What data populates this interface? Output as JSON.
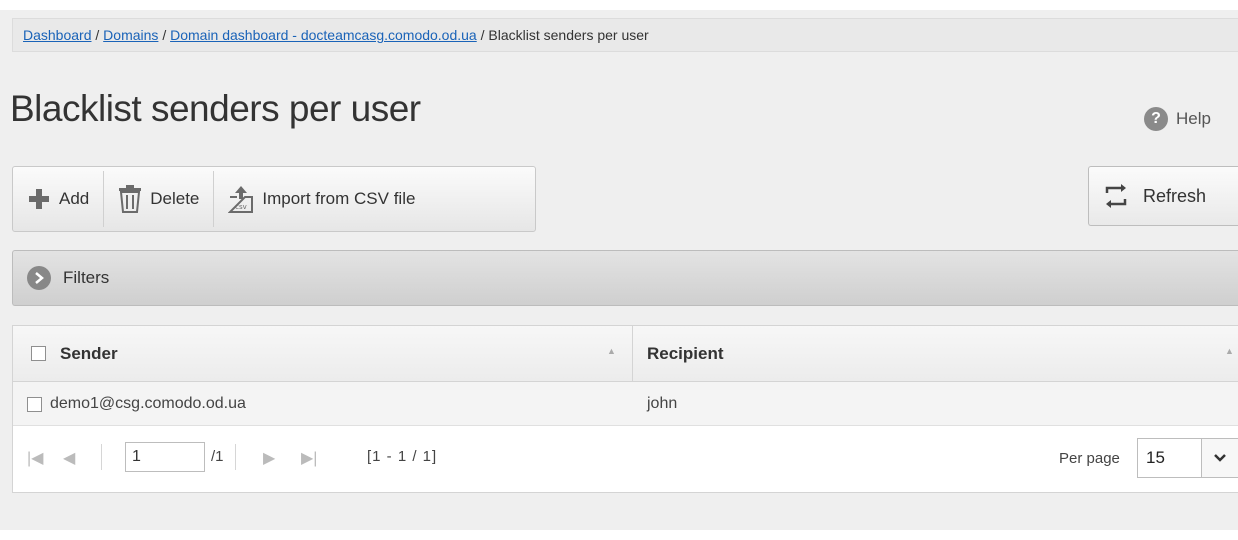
{
  "breadcrumb": {
    "items": [
      {
        "label": "Dashboard"
      },
      {
        "label": "Domains"
      },
      {
        "label": "Domain dashboard - docteamcasg.comodo.od.ua"
      }
    ],
    "current": "Blacklist senders per user",
    "separator": "/"
  },
  "page": {
    "title": "Blacklist senders per user",
    "help_label": "Help"
  },
  "toolbar": {
    "add_label": "Add",
    "delete_label": "Delete",
    "import_label": "Import from CSV file",
    "refresh_label": "Refresh"
  },
  "filters": {
    "label": "Filters"
  },
  "table": {
    "columns": [
      "Sender",
      "Recipient"
    ],
    "rows": [
      {
        "sender": "demo1@csg.comodo.od.ua",
        "recipient": "john"
      }
    ]
  },
  "pagination": {
    "current_page": "1",
    "total_pages": "/1",
    "range": "[1 - 1 / 1]",
    "per_page_label": "Per page",
    "per_page_value": "15"
  },
  "colors": {
    "link": "#1a63b8",
    "page_bg": "#efefef",
    "icon_gray": "#888888"
  }
}
